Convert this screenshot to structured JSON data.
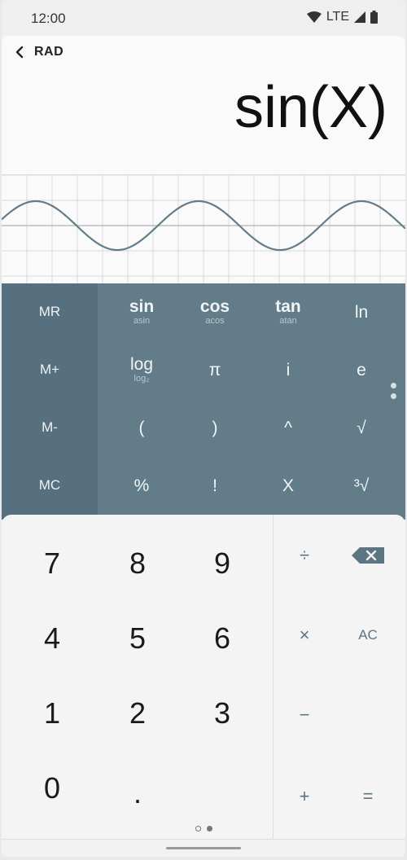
{
  "status": {
    "time": "12:00",
    "network": "LTE"
  },
  "display": {
    "mode": "RAD",
    "expression": "sin(X)"
  },
  "memory": [
    "MR",
    "M+",
    "M-",
    "MC"
  ],
  "functions": {
    "sin": {
      "main": "sin",
      "sub": "asin"
    },
    "cos": {
      "main": "cos",
      "sub": "acos"
    },
    "tan": {
      "main": "tan",
      "sub": "atan"
    },
    "ln": "ln",
    "log": {
      "main": "log",
      "sub": "log₂"
    },
    "pi": "π",
    "i": "i",
    "e": "e",
    "lparen": "(",
    "rparen": ")",
    "power": "^",
    "sqrt": "√",
    "percent": "%",
    "factorial": "!",
    "variable": "X",
    "cbrt": "³√"
  },
  "keys": {
    "k7": "7",
    "k8": "8",
    "k9": "9",
    "k4": "4",
    "k5": "5",
    "k6": "6",
    "k1": "1",
    "k2": "2",
    "k3": "3",
    "k0": "0",
    "dot": "."
  },
  "ops": {
    "divide": "÷",
    "multiply": "×",
    "minus": "−",
    "plus": "+",
    "clear": "AC",
    "equals": "="
  },
  "colors": {
    "sci_bg": "#627c89",
    "mem_bg": "#567080",
    "curve": "#627c89",
    "accent": "#5c7582"
  }
}
